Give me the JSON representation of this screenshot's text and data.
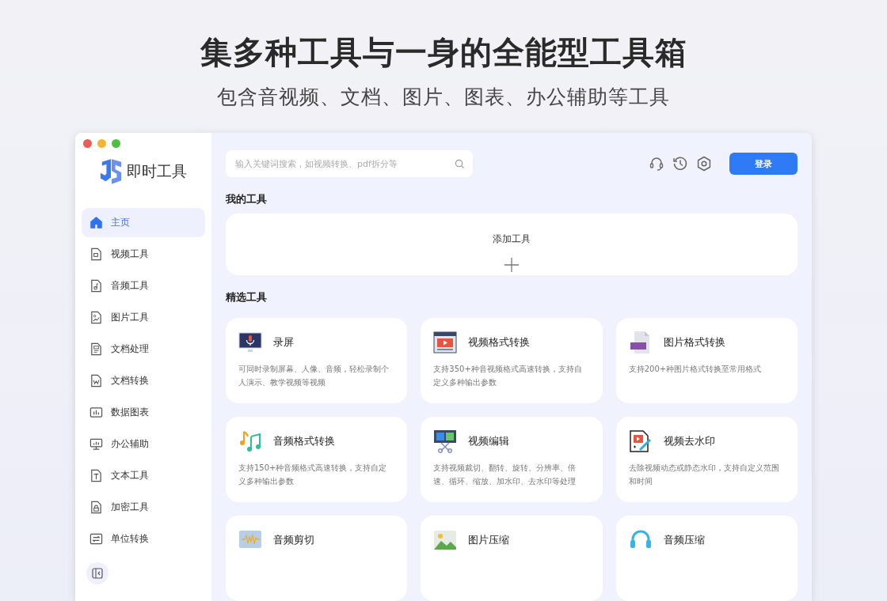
{
  "headline": "集多种工具与一身的全能型工具箱",
  "subheadline": "包含音视频、文档、图片、图表、办公辅助等工具",
  "app": {
    "name": "即时工具"
  },
  "sidebar": {
    "items": [
      {
        "label": "主页",
        "selected": true
      },
      {
        "label": "视频工具",
        "selected": false
      },
      {
        "label": "音频工具",
        "selected": false
      },
      {
        "label": "图片工具",
        "selected": false
      },
      {
        "label": "文档处理",
        "selected": false
      },
      {
        "label": "文档转换",
        "selected": false
      },
      {
        "label": "数据图表",
        "selected": false
      },
      {
        "label": "办公辅助",
        "selected": false
      },
      {
        "label": "文本工具",
        "selected": false
      },
      {
        "label": "加密工具",
        "selected": false
      },
      {
        "label": "单位转换",
        "selected": false
      }
    ]
  },
  "search": {
    "placeholder": "输入关键词搜索，如视频转换、pdf拆分等"
  },
  "login_button": "登录",
  "my_tools": {
    "heading": "我的工具",
    "add_label": "添加工具"
  },
  "featured": {
    "heading": "精选工具",
    "tools": [
      {
        "title": "录屏",
        "description": "可同时录制屏幕、人像、音频，轻松录制个人演示、教学视频等视频"
      },
      {
        "title": "视频格式转换",
        "description": "支持350+种音视频格式高速转换，支持自定义多种输出参数"
      },
      {
        "title": "图片格式转换",
        "description": "支持200+种图片格式转换至常用格式"
      },
      {
        "title": "音频格式转换",
        "description": "支持150+种音频格式高速转换，支持自定义多种输出参数"
      },
      {
        "title": "视频编辑",
        "description": "支持视频裁切、翻转、旋转、分辨率、倍速、循环、缩放、加水印、去水印等处理"
      },
      {
        "title": "视频去水印",
        "description": "去除视频动态或静态水印，支持自定义范围和时间"
      },
      {
        "title": "音频剪切"
      },
      {
        "title": "图片压缩"
      },
      {
        "title": "音频压缩"
      }
    ]
  }
}
